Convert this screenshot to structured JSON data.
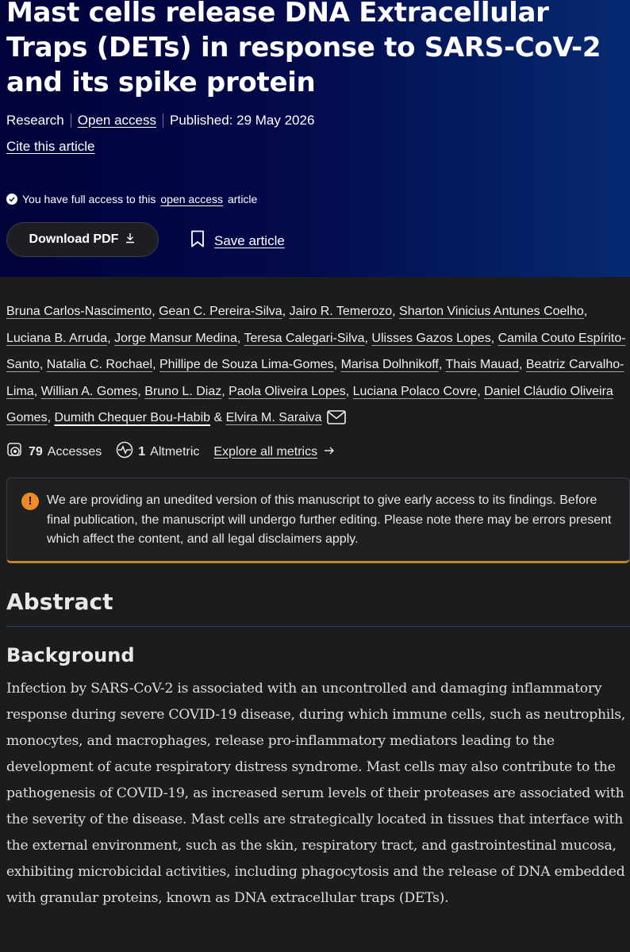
{
  "article": {
    "title": "Mast cells release DNA Extracellular Traps (DETs) in response to SARS-CoV-2 and its spike protein",
    "type": "Research",
    "open_access_label": "Open access",
    "published": "Published: 29 May 2026",
    "cite_label": "Cite this article"
  },
  "access": {
    "prefix": "You have full access to this",
    "link": "open access",
    "suffix": "article"
  },
  "actions": {
    "download_label": "Download PDF",
    "save_label": "Save article"
  },
  "authors": [
    "Bruna Carlos-Nascimento",
    "Gean C. Pereira-Silva",
    "Jairo R. Temerozo",
    "Sharton Vinicius Antunes Coelho",
    "Luciana B. Arruda",
    "Jorge Mansur Medina",
    "Teresa Calegari-Silva",
    "Ulisses Gazos Lopes",
    "Camila Couto Espírito-Santo",
    "Natalia C. Rochael",
    "Phillipe de Souza Lima-Gomes",
    "Marisa Dolhnikoff",
    "Thais Mauad",
    "Beatriz Carvalho-Lima",
    "Willian A. Gomes",
    "Bruno L. Diaz",
    "Paola Oliveira Lopes",
    "Luciana Polaco Covre",
    "Daniel Cláudio Oliveira Gomes",
    "Dumith Chequer Bou-Habib",
    "Elvira M. Saraiva"
  ],
  "metrics": {
    "accesses_count": "79",
    "accesses_label": "Accesses",
    "altmetric_count": "1",
    "altmetric_label": "Altmetric",
    "explore_label": "Explore all metrics"
  },
  "notice": {
    "text": "We are providing an unedited version of this manuscript to give early access to its findings. Before final publication, the manuscript will undergo further editing. Please note there may be errors present which affect the content, and all legal disclaimers apply."
  },
  "abstract": {
    "heading": "Abstract",
    "section_heading": "Background",
    "section_text": "Infection by SARS-CoV-2 is associated with an uncontrolled and damaging inflammatory response during severe COVID-19 disease, during which immune cells, such as neutrophils, monocytes, and macrophages, release pro-inflammatory mediators leading to the development of acute respiratory distress syndrome. Mast cells may also contribute to the pathogenesis of COVID-19, as increased serum levels of their proteases are associated with the severity of the disease. Mast cells are strategically located in tissues that interface with the external environment, such as the skin, respiratory tract, and gastrointestinal mucosa, exhibiting microbicidal activities, including phagocytosis and the release of DNA embedded with granular proteins, known as DNA extracellular traps (DETs)."
  }
}
